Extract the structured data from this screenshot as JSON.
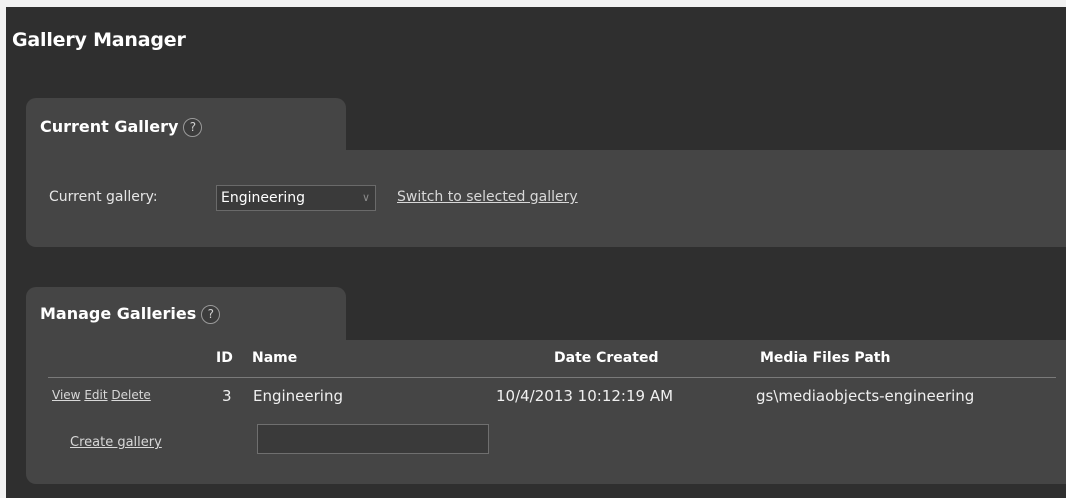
{
  "page": {
    "title": "Gallery Manager"
  },
  "current_gallery": {
    "title": "Current Gallery",
    "help": "?",
    "label": "Current gallery:",
    "selected": "Engineering",
    "switch_link": "Switch to selected gallery"
  },
  "manage": {
    "title": "Manage Galleries",
    "help": "?",
    "columns": {
      "id": "ID",
      "name": "Name",
      "date": "Date Created",
      "path": "Media Files Path"
    },
    "rows": [
      {
        "view": "View",
        "edit": "Edit",
        "delete": "Delete",
        "id": "3",
        "name": "Engineering",
        "date": "10/4/2013 10:12:19 AM",
        "path": "gs\\mediaobjects-engineering"
      }
    ],
    "create_link": "Create gallery",
    "create_value": ""
  }
}
